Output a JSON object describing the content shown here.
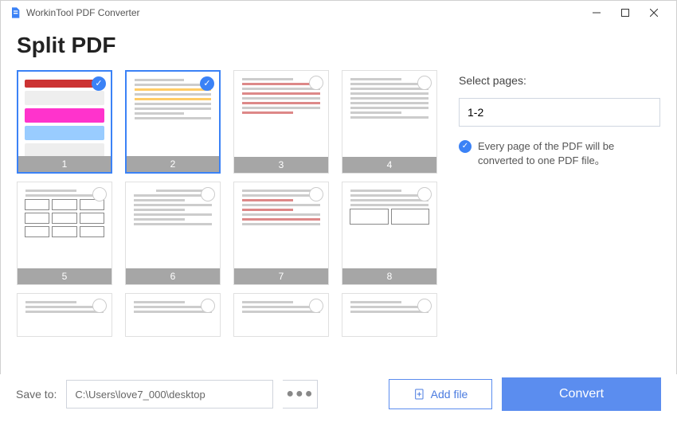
{
  "app_title": "WorkinTool PDF Converter",
  "page_heading": "Split PDF",
  "thumbs": [
    {
      "n": "1",
      "selected": true
    },
    {
      "n": "2",
      "selected": true
    },
    {
      "n": "3",
      "selected": false
    },
    {
      "n": "4",
      "selected": false
    },
    {
      "n": "5",
      "selected": false
    },
    {
      "n": "6",
      "selected": false
    },
    {
      "n": "7",
      "selected": false
    },
    {
      "n": "8",
      "selected": false
    }
  ],
  "side": {
    "select_label": "Select pages:",
    "range_value": "1-2",
    "info_text": "Every page of the PDF will be converted to one PDF file。"
  },
  "footer": {
    "saveto_label": "Save to:",
    "path": "C:\\Users\\love7_000\\desktop",
    "browse": "●●●",
    "addfile": "Add file",
    "convert": "Convert"
  }
}
